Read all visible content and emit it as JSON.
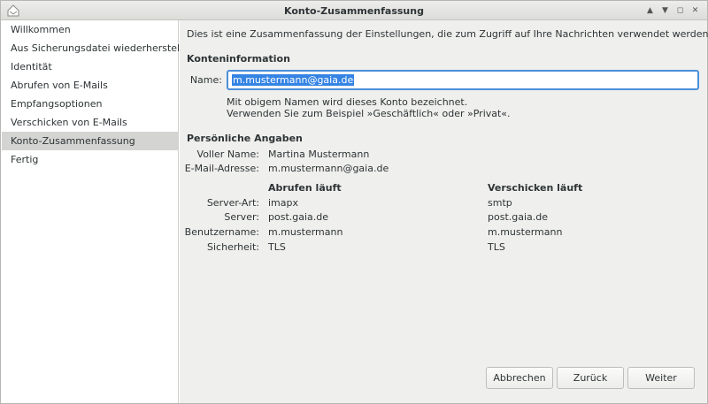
{
  "window": {
    "title": "Konto-Zusammenfassung",
    "controls": [
      "▲",
      "▼",
      "◻",
      "✕"
    ]
  },
  "sidebar": {
    "items": [
      {
        "label": "Willkommen"
      },
      {
        "label": "Aus Sicherungsdatei wiederherstellen"
      },
      {
        "label": "Identität"
      },
      {
        "label": "Abrufen von E-Mails"
      },
      {
        "label": "Empfangsoptionen"
      },
      {
        "label": "Verschicken von E-Mails"
      },
      {
        "label": "Konto-Zusammenfassung",
        "selected": true
      },
      {
        "label": "Fertig"
      }
    ]
  },
  "main": {
    "intro": "Dies ist eine Zusammenfassung der Einstellungen, die zum Zugriff auf Ihre Nachrichten verwendet werden.",
    "account_info": {
      "heading": "Konteninformation",
      "name_label": "Name:",
      "name_value": "m.mustermann@gaia.de",
      "hint_line1": "Mit obigem Namen wird dieses Konto bezeichnet.",
      "hint_line2": "Verwenden Sie zum Beispiel »Geschäftlich« oder »Privat«."
    },
    "personal": {
      "heading": "Persönliche Angaben",
      "fullname_label": "Voller Name:",
      "fullname_value": "Martina Mustermann",
      "email_label": "E-Mail-Adresse:",
      "email_value": "m.mustermann@gaia.de"
    },
    "servers": {
      "col_incoming": "Abrufen läuft",
      "col_outgoing": "Verschicken läuft",
      "rows": [
        {
          "label": "Server-Art:",
          "incoming": "imapx",
          "outgoing": "smtp"
        },
        {
          "label": "Server:",
          "incoming": "post.gaia.de",
          "outgoing": "post.gaia.de"
        },
        {
          "label": "Benutzername:",
          "incoming": "m.mustermann",
          "outgoing": "m.mustermann"
        },
        {
          "label": "Sicherheit:",
          "incoming": "TLS",
          "outgoing": "TLS"
        }
      ]
    }
  },
  "buttons": {
    "cancel": "Abbrechen",
    "back": "Zurück",
    "next": "Weiter"
  }
}
